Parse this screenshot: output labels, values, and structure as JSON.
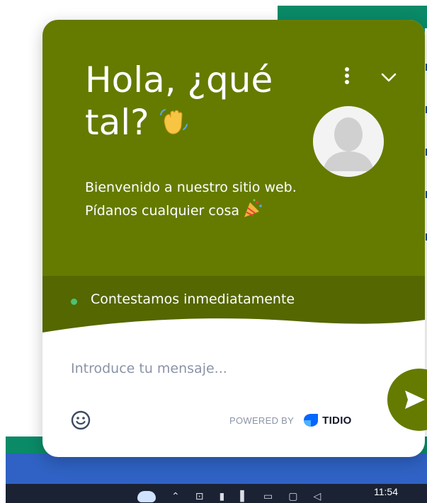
{
  "widget": {
    "title_line1": "Hola, ¿qué",
    "title_line2": "tal?",
    "title_emoji_icon": "waving-hand-icon",
    "subtitle": "Bienvenido a nuestro sitio web. Pídanos cualquier cosa",
    "subtitle_emoji_icon": "party-popper-icon",
    "menu_icon": "vertical-dots-icon",
    "collapse_icon": "chevron-down-icon",
    "avatar_icon": "default-user-avatar",
    "status_text": "Contestamos inmediatamente",
    "status_color": "#4cc271",
    "input_placeholder": "Introduce tu mensaje...",
    "emoji_button_icon": "smiley-icon",
    "send_button_icon": "send-arrow-icon",
    "powered_by": "POWERED BY",
    "brand_name": "TIDIO",
    "brand_color": "#0566ff",
    "header_color": "#647b00",
    "status_bar_color": "#546700"
  },
  "taskbar": {
    "clock": "11:54",
    "tray_icons": [
      "cloud-icon",
      "chevron-up-icon",
      "camera-icon",
      "usb-icon",
      "battery-icon",
      "network-icon",
      "display-icon",
      "speaker-icon"
    ]
  }
}
